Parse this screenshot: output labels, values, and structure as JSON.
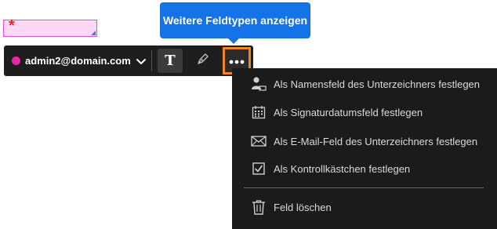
{
  "field": {
    "required_marker": "*"
  },
  "tooltip": {
    "text": "Weitere Feldtypen anzeigen"
  },
  "toolbar": {
    "recipient": "admin2@domain.com",
    "recipient_color": "#e926a8",
    "text_tool_label": "T",
    "more_highlight_color": "#f08522",
    "icons": [
      "chevron-down-icon",
      "pen-icon",
      "more-icon"
    ]
  },
  "menu": {
    "items": [
      {
        "label": "Als Namensfeld des Unterzeichners festlegen",
        "icon": "person-name-icon"
      },
      {
        "label": "Als Signaturdatumsfeld festlegen",
        "icon": "calendar-icon"
      },
      {
        "label": "Als E-Mail-Feld des Unterzeichners festlegen",
        "icon": "envelope-icon"
      },
      {
        "label": "Als Kontrollkästchen festlegen",
        "icon": "checkbox-icon"
      }
    ],
    "delete_label": "Feld löschen",
    "delete_icon": "trash-icon"
  },
  "colors": {
    "accent": "#1473e6",
    "field_fill": "#fcd8f4",
    "field_border": "#e64fc5"
  }
}
